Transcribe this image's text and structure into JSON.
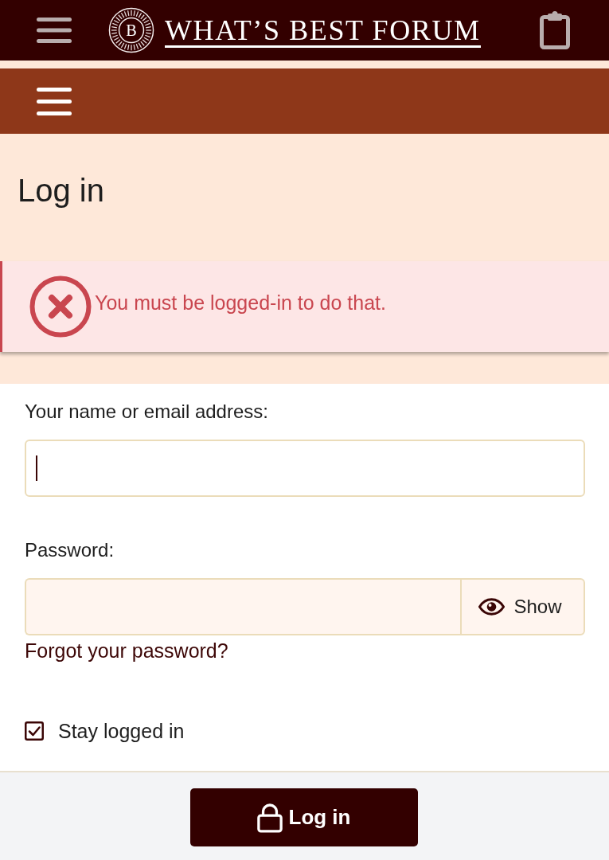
{
  "header": {
    "logo_letter": "B",
    "logo_text": "WHAT’S BEST FORUM"
  },
  "page": {
    "title": "Log in"
  },
  "alert": {
    "kind": "error",
    "message": "You must be logged-in to do that."
  },
  "form": {
    "fields": [
      {
        "kind": "text",
        "label": "Your name or email address:",
        "focused": true
      },
      {
        "kind": "password",
        "label": "Password:",
        "reveal_button": "Show"
      }
    ],
    "forgot_link": "Forgot your password?",
    "stay_logged_in": {
      "label": "Stay logged in",
      "checked": true
    }
  },
  "submit_button": {
    "label": "Log in"
  }
}
